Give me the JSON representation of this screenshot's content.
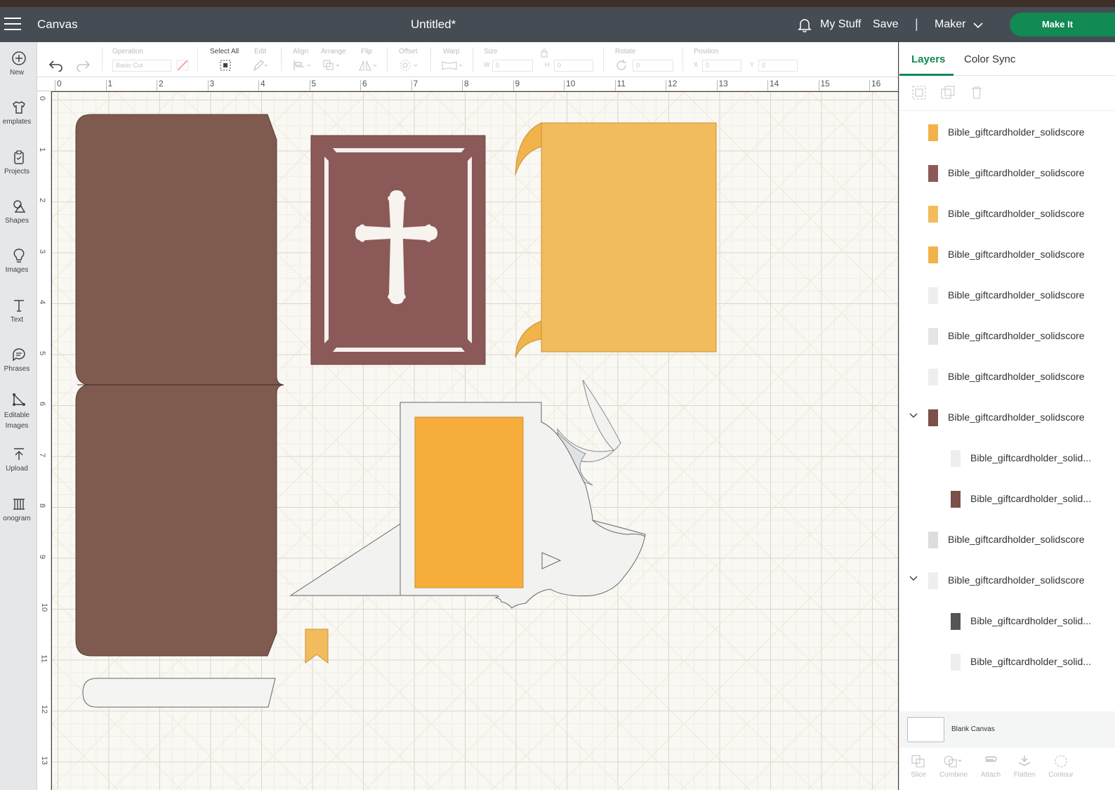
{
  "topbar": {
    "app_title": "Canvas",
    "doc_title": "Untitled*",
    "my_stuff": "My Stuff",
    "save": "Save",
    "separator": "|",
    "machine": "Maker",
    "make_it": "Make It",
    "accent_color": "#118a53"
  },
  "left_tools": [
    {
      "label": "New",
      "icon": "plus-circle-icon"
    },
    {
      "label": "emplates",
      "icon": "shirt-icon"
    },
    {
      "label": "Projects",
      "icon": "clipboard-icon"
    },
    {
      "label": "Shapes",
      "icon": "shapes-icon"
    },
    {
      "label": "Images",
      "icon": "bulb-icon"
    },
    {
      "label": "Text",
      "icon": "text-icon"
    },
    {
      "label": "Phrases",
      "icon": "speech-bubble-icon"
    },
    {
      "label": "Editable\nImages",
      "icon": "editable-images-icon"
    },
    {
      "label": "Upload",
      "icon": "upload-icon"
    },
    {
      "label": "onogram",
      "icon": "monogram-icon"
    }
  ],
  "toolbar": {
    "operation_label": "Operation",
    "operation_value": "Basic Cut",
    "select_all": "Select All",
    "edit": "Edit",
    "align": "Align",
    "arrange": "Arrange",
    "flip": "Flip",
    "offset": "Offset",
    "warp": "Warp",
    "size": "Size",
    "size_w": "W",
    "size_w_val": "0",
    "size_h": "H",
    "size_h_val": "0",
    "rotate": "Rotate",
    "rotate_val": "0",
    "position": "Position",
    "pos_x": "X",
    "pos_x_val": "0",
    "pos_y": "Y",
    "pos_y_val": "0"
  },
  "ruler": {
    "top": [
      "0",
      "1",
      "2",
      "3",
      "4",
      "5",
      "6",
      "7",
      "8",
      "9",
      "10",
      "11",
      "12",
      "13",
      "14",
      "15",
      "16"
    ],
    "left": [
      "0",
      "1",
      "2",
      "3",
      "4",
      "5",
      "6",
      "7",
      "8",
      "9",
      "10",
      "11",
      "12",
      "13"
    ]
  },
  "panel": {
    "tab_layers": "Layers",
    "tab_color_sync": "Color Sync",
    "layers": [
      {
        "name": "Bible_giftcardholder_solidscore",
        "thumb": "#f2b24a",
        "indent": false,
        "expand": false
      },
      {
        "name": "Bible_giftcardholder_solidscore",
        "thumb": "#8b5a58",
        "indent": false,
        "expand": false
      },
      {
        "name": "Bible_giftcardholder_solidscore",
        "thumb": "#f2bb5b",
        "indent": false,
        "expand": false
      },
      {
        "name": "Bible_giftcardholder_solidscore",
        "thumb": "#f2b24a",
        "indent": false,
        "expand": false
      },
      {
        "name": "Bible_giftcardholder_solidscore",
        "thumb": "#eeeeee",
        "indent": false,
        "expand": false
      },
      {
        "name": "Bible_giftcardholder_solidscore",
        "thumb": "#e3e6e8",
        "indent": false,
        "expand": false
      },
      {
        "name": "Bible_giftcardholder_solidscore",
        "thumb": "#eeeeee",
        "indent": false,
        "expand": false
      },
      {
        "name": "Bible_giftcardholder_solidscore",
        "thumb": "#7a5048",
        "indent": false,
        "expand": true
      },
      {
        "name": "Bible_giftcardholder_solid...",
        "thumb": "#eeeeee",
        "indent": true,
        "expand": false
      },
      {
        "name": "Bible_giftcardholder_solid...",
        "thumb": "#7a5048",
        "indent": true,
        "expand": false
      },
      {
        "name": "Bible_giftcardholder_solidscore",
        "thumb": "#dddddd",
        "indent": false,
        "expand": false
      },
      {
        "name": "Bible_giftcardholder_solidscore",
        "thumb": "#eeeeee",
        "indent": false,
        "expand": true
      },
      {
        "name": "Bible_giftcardholder_solid...",
        "thumb": "#555555",
        "indent": true,
        "expand": false
      },
      {
        "name": "Bible_giftcardholder_solid...",
        "thumb": "#eeeeee",
        "indent": true,
        "expand": false
      }
    ],
    "blank_canvas": "Blank Canvas",
    "bottom_actions": [
      "Slice",
      "Combine",
      "Attach",
      "Flatten",
      "Contour"
    ]
  },
  "colors": {
    "brown": "#7f5a4e",
    "mauve": "#8b5a58",
    "gold": "#f2bb5b",
    "orange": "#f6ad3b",
    "white_piece": "#f2f2f1"
  }
}
